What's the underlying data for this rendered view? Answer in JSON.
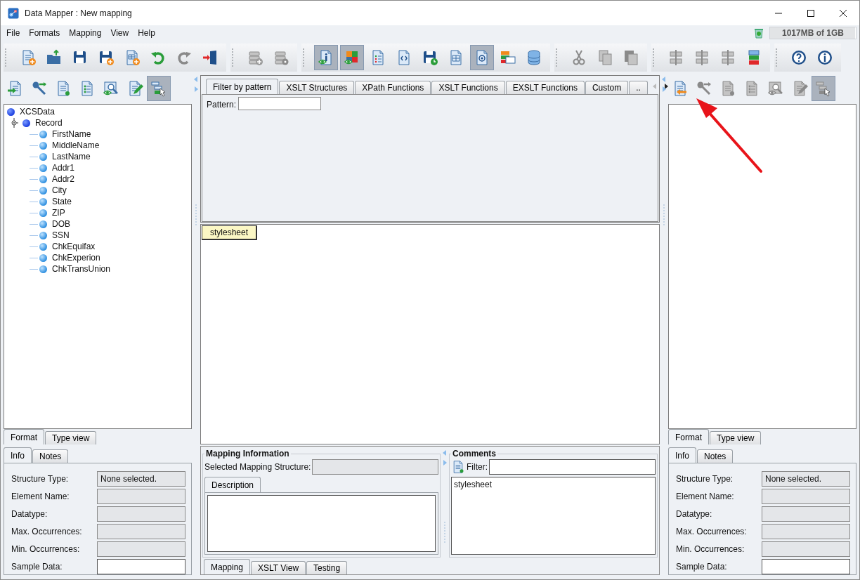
{
  "window": {
    "title": "Data Mapper : New mapping"
  },
  "menu": [
    "File",
    "Formats",
    "Mapping",
    "View",
    "Help"
  ],
  "memory": {
    "label": "1017MB of 1GB",
    "level": 0.99
  },
  "toolbar": [
    {
      "buttons": [
        {
          "pressed": false,
          "disabled": false
        },
        {
          "pressed": false,
          "disabled": false
        },
        {
          "pressed": false,
          "disabled": false
        },
        {
          "pressed": false,
          "disabled": false
        },
        {
          "pressed": false,
          "disabled": false
        },
        {
          "pressed": false,
          "disabled": false
        },
        {
          "pressed": false,
          "disabled": true
        },
        {
          "pressed": false,
          "disabled": false
        }
      ]
    },
    {
      "buttons": [
        {
          "pressed": false,
          "disabled": true
        },
        {
          "pressed": false,
          "disabled": true
        }
      ]
    },
    {
      "buttons": [
        {
          "pressed": true,
          "disabled": false
        },
        {
          "pressed": true,
          "disabled": false
        },
        {
          "pressed": false,
          "disabled": false
        },
        {
          "pressed": false,
          "disabled": false
        },
        {
          "pressed": false,
          "disabled": false
        },
        {
          "pressed": false,
          "disabled": false
        },
        {
          "pressed": true,
          "disabled": false
        },
        {
          "pressed": false,
          "disabled": false
        },
        {
          "pressed": false,
          "disabled": false
        }
      ]
    },
    {
      "buttons": [
        {
          "pressed": false,
          "disabled": true
        },
        {
          "pressed": false,
          "disabled": true
        },
        {
          "pressed": false,
          "disabled": true
        }
      ]
    },
    {
      "buttons": [
        {
          "pressed": false,
          "disabled": true
        },
        {
          "pressed": false,
          "disabled": true
        },
        {
          "pressed": false,
          "disabled": true
        },
        {
          "pressed": false,
          "disabled": false
        }
      ]
    },
    {
      "buttons": [
        {
          "pressed": false,
          "disabled": false
        },
        {
          "pressed": false,
          "disabled": false
        }
      ]
    }
  ],
  "left_panel": {
    "toolbar": [
      {
        "pressed": false,
        "disabled": false
      },
      {
        "pressed": false,
        "disabled": false
      },
      {
        "pressed": false,
        "disabled": false
      },
      {
        "pressed": false,
        "disabled": false
      },
      {
        "pressed": false,
        "disabled": false
      },
      {
        "pressed": false,
        "disabled": false
      },
      {
        "pressed": true,
        "disabled": false
      }
    ],
    "tree": [
      {
        "label": "XCSData",
        "children": [
          {
            "label": "Record",
            "expanded": true,
            "children": [
              {
                "label": "FirstName"
              },
              {
                "label": "MiddleName"
              },
              {
                "label": "LastName"
              },
              {
                "label": "Addr1"
              },
              {
                "label": "Addr2"
              },
              {
                "label": "City"
              },
              {
                "label": "State"
              },
              {
                "label": "ZIP"
              },
              {
                "label": "DOB"
              },
              {
                "label": "SSN"
              },
              {
                "label": "ChkEquifax"
              },
              {
                "label": "ChkExperion"
              },
              {
                "label": "ChkTransUnion"
              }
            ]
          }
        ]
      }
    ],
    "view_tabs": [
      {
        "label": "Format",
        "selected": true
      },
      {
        "label": "Type view",
        "selected": false
      }
    ],
    "info_tabs": [
      {
        "label": "Info",
        "selected": true
      },
      {
        "label": "Notes",
        "selected": false
      }
    ],
    "fields": [
      {
        "label": "Structure Type:",
        "value": "None selected.",
        "editable": false
      },
      {
        "label": "Element Name:",
        "editable": false
      },
      {
        "label": "Datatype:",
        "editable": false
      },
      {
        "label": "Max. Occurrences:",
        "editable": false
      },
      {
        "label": "Min. Occurrences:",
        "editable": false
      },
      {
        "label": "Sample Data:",
        "editable": true
      }
    ]
  },
  "center": {
    "tabs": [
      {
        "label": "Filter by pattern",
        "selected": true
      },
      {
        "label": "XSLT Structures",
        "selected": false
      },
      {
        "label": "XPath Functions",
        "selected": false
      },
      {
        "label": "XSLT Functions",
        "selected": false
      },
      {
        "label": "EXSLT Functions",
        "selected": false
      },
      {
        "label": "Custom",
        "selected": false
      },
      {
        "label": "..",
        "selected": false
      }
    ],
    "pattern": {
      "label": "Pattern:"
    },
    "canvas": {
      "nodes": [
        {
          "label": "stylesheet"
        }
      ]
    },
    "mapping_info": {
      "title": "Mapping Information",
      "structure_label": "Selected Mapping Structure:",
      "tabs": [
        {
          "label": "Description",
          "selected": true
        }
      ]
    },
    "comments": {
      "title": "Comments",
      "filter_label": "Filter:",
      "items": [
        "stylesheet"
      ]
    },
    "bottom_tabs": [
      {
        "label": "Mapping",
        "selected": true
      },
      {
        "label": "XSLT View",
        "selected": false
      },
      {
        "label": "Testing",
        "selected": false
      }
    ]
  },
  "right_panel": {
    "toolbar": [
      {
        "pressed": false,
        "disabled": false
      },
      {
        "pressed": false,
        "disabled": true
      },
      {
        "pressed": false,
        "disabled": true
      },
      {
        "pressed": false,
        "disabled": true
      },
      {
        "pressed": false,
        "disabled": true
      },
      {
        "pressed": false,
        "disabled": true
      },
      {
        "pressed": true,
        "disabled": true
      }
    ],
    "view_tabs": [
      {
        "label": "Format",
        "selected": true
      },
      {
        "label": "Type view",
        "selected": false
      }
    ],
    "info_tabs": [
      {
        "label": "Info",
        "selected": true
      },
      {
        "label": "Notes",
        "selected": false
      }
    ],
    "fields": [
      {
        "label": "Structure Type:",
        "value": "None selected.",
        "editable": false
      },
      {
        "label": "Element Name:",
        "editable": false
      },
      {
        "label": "Datatype:",
        "editable": false
      },
      {
        "label": "Max. Occurrences:",
        "editable": false
      },
      {
        "label": "Min. Occurrences:",
        "editable": false
      },
      {
        "label": "Sample Data:",
        "editable": true
      }
    ]
  }
}
